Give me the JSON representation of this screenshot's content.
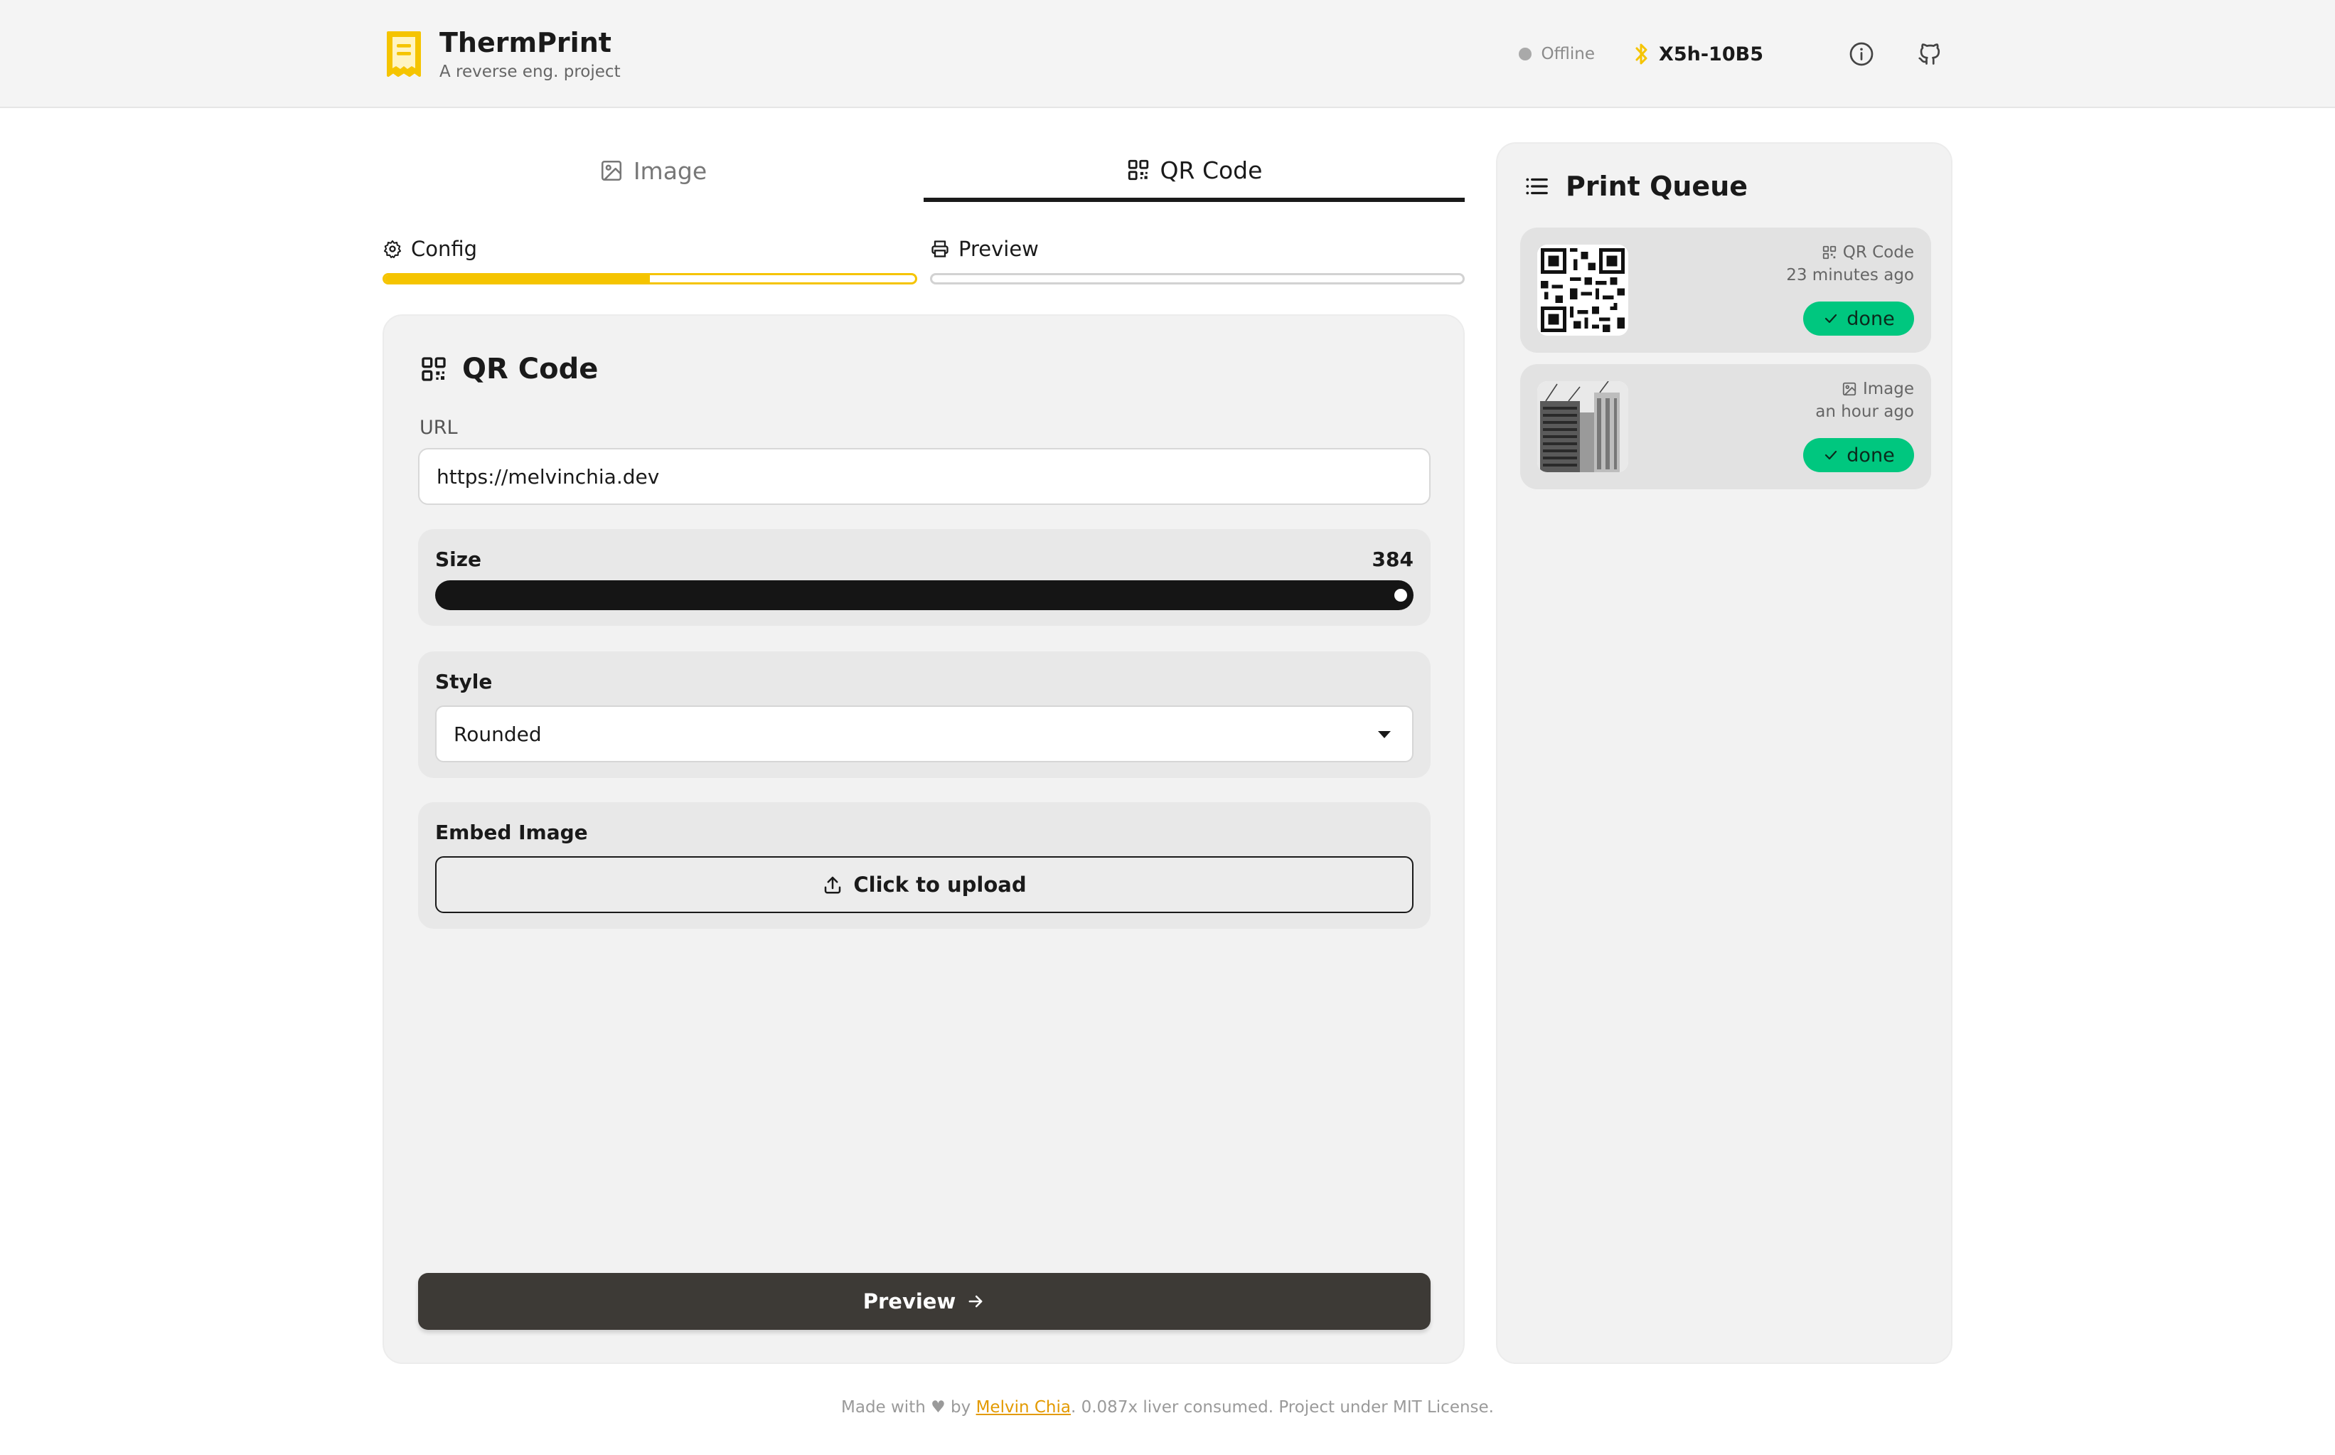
{
  "app": {
    "title": "ThermPrint",
    "subtitle": "A reverse eng. project",
    "brand_color": "#f5c400"
  },
  "header": {
    "status_text": "Offline",
    "device_name": "X5h-10B5",
    "icons": [
      "receipt-icon",
      "bluetooth-icon",
      "info-icon",
      "github-icon"
    ]
  },
  "tabs": [
    {
      "label": "Image",
      "icon": "image-icon",
      "active": false
    },
    {
      "label": "QR Code",
      "icon": "qr-code-icon",
      "active": true
    }
  ],
  "steps": [
    {
      "label": "Config",
      "icon": "gear-icon",
      "progress": 0.5
    },
    {
      "label": "Preview",
      "icon": "printer-icon",
      "progress": 0
    }
  ],
  "form": {
    "title": "QR Code",
    "url_label": "URL",
    "url_value": "https://melvinchia.dev",
    "size_label": "Size",
    "size_value": "384",
    "size_fraction": 1.0,
    "style_label": "Style",
    "style_value": "Rounded",
    "embed_label": "Embed Image",
    "upload_label": "Click to upload",
    "preview_button": "Preview"
  },
  "queue": {
    "title": "Print Queue",
    "items": [
      {
        "type": "QR Code",
        "time": "23 minutes ago",
        "status": "done",
        "thumb": "qr-thumbnail"
      },
      {
        "type": "Image",
        "time": "an hour ago",
        "status": "done",
        "thumb": "building-photo-thumbnail"
      }
    ],
    "done_color": "#00c77f"
  },
  "footer": {
    "prefix": "Made with",
    "by": "by",
    "author": "Melvin Chia",
    "suffix": ". 0.087x liver consumed. Project under MIT License."
  }
}
